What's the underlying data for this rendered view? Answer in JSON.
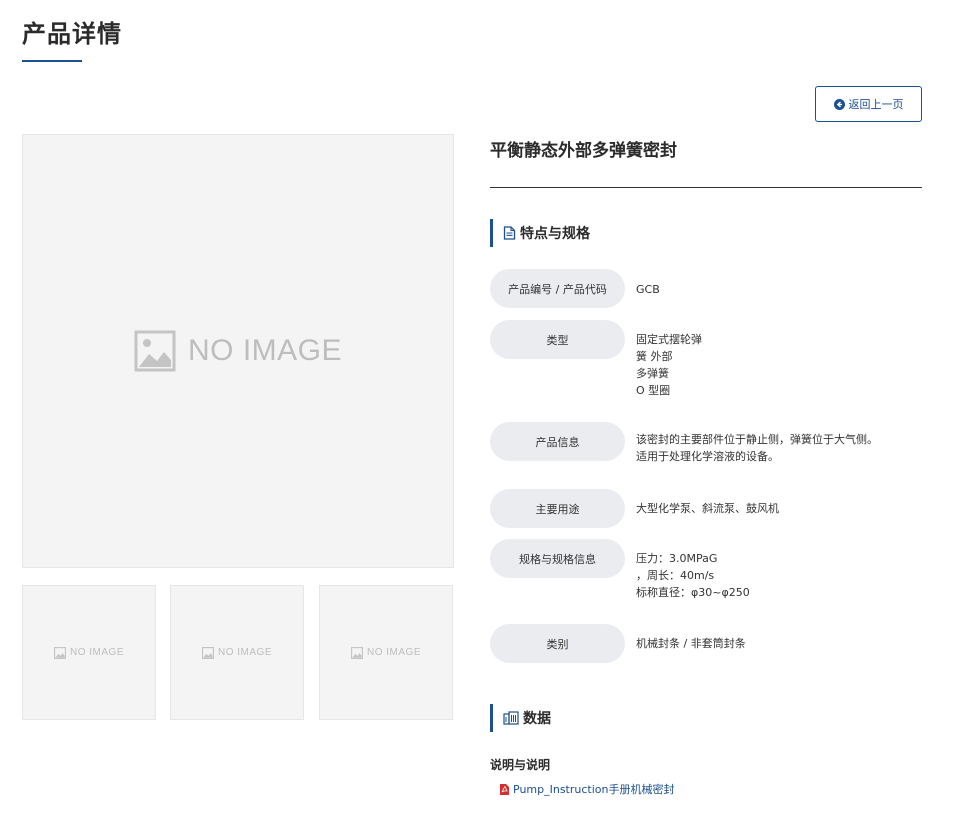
{
  "page": {
    "title": "产品详情"
  },
  "back_button": {
    "label": "返回上一页"
  },
  "product": {
    "name": "平衡静态外部多弹簧密封"
  },
  "images": {
    "main_placeholder": "NO IMAGE",
    "thumbnails": [
      "NO IMAGE",
      "NO IMAGE",
      "NO IMAGE"
    ]
  },
  "specs_section": {
    "title": "特点与规格"
  },
  "specs": [
    {
      "label": "产品编号 / 产品代码",
      "lines": [
        "GCB"
      ]
    },
    {
      "label": "类型",
      "lines": [
        "固定式摆轮弹",
        "簧 外部",
        "多弹簧",
        "O 型圈"
      ]
    },
    {
      "label": "产品信息",
      "lines": [
        "该密封的主要部件位于静止侧，弹簧位于大气侧。",
        "适用于处理化学溶液的设备。"
      ]
    },
    {
      "label": "主要用途",
      "lines": [
        "大型化学泵、斜流泵、鼓风机"
      ]
    },
    {
      "label": "规格与规格信息",
      "lines": [
        "压力：3.0MPaG",
        "，周长：40m/s",
        "标称直径：φ30~φ250"
      ]
    },
    {
      "label": "类别",
      "lines": [
        "机械封条 / 非套筒封条"
      ]
    }
  ],
  "data_section": {
    "title": "数据",
    "subheading": "说明与说明",
    "link_label": "Pump_Instruction手册机械密封"
  },
  "colors": {
    "accent": "#1c4f93",
    "pill": "#eaecef",
    "placeholder_bg": "#f4f4f4",
    "pdf_red": "#d32f2f"
  }
}
